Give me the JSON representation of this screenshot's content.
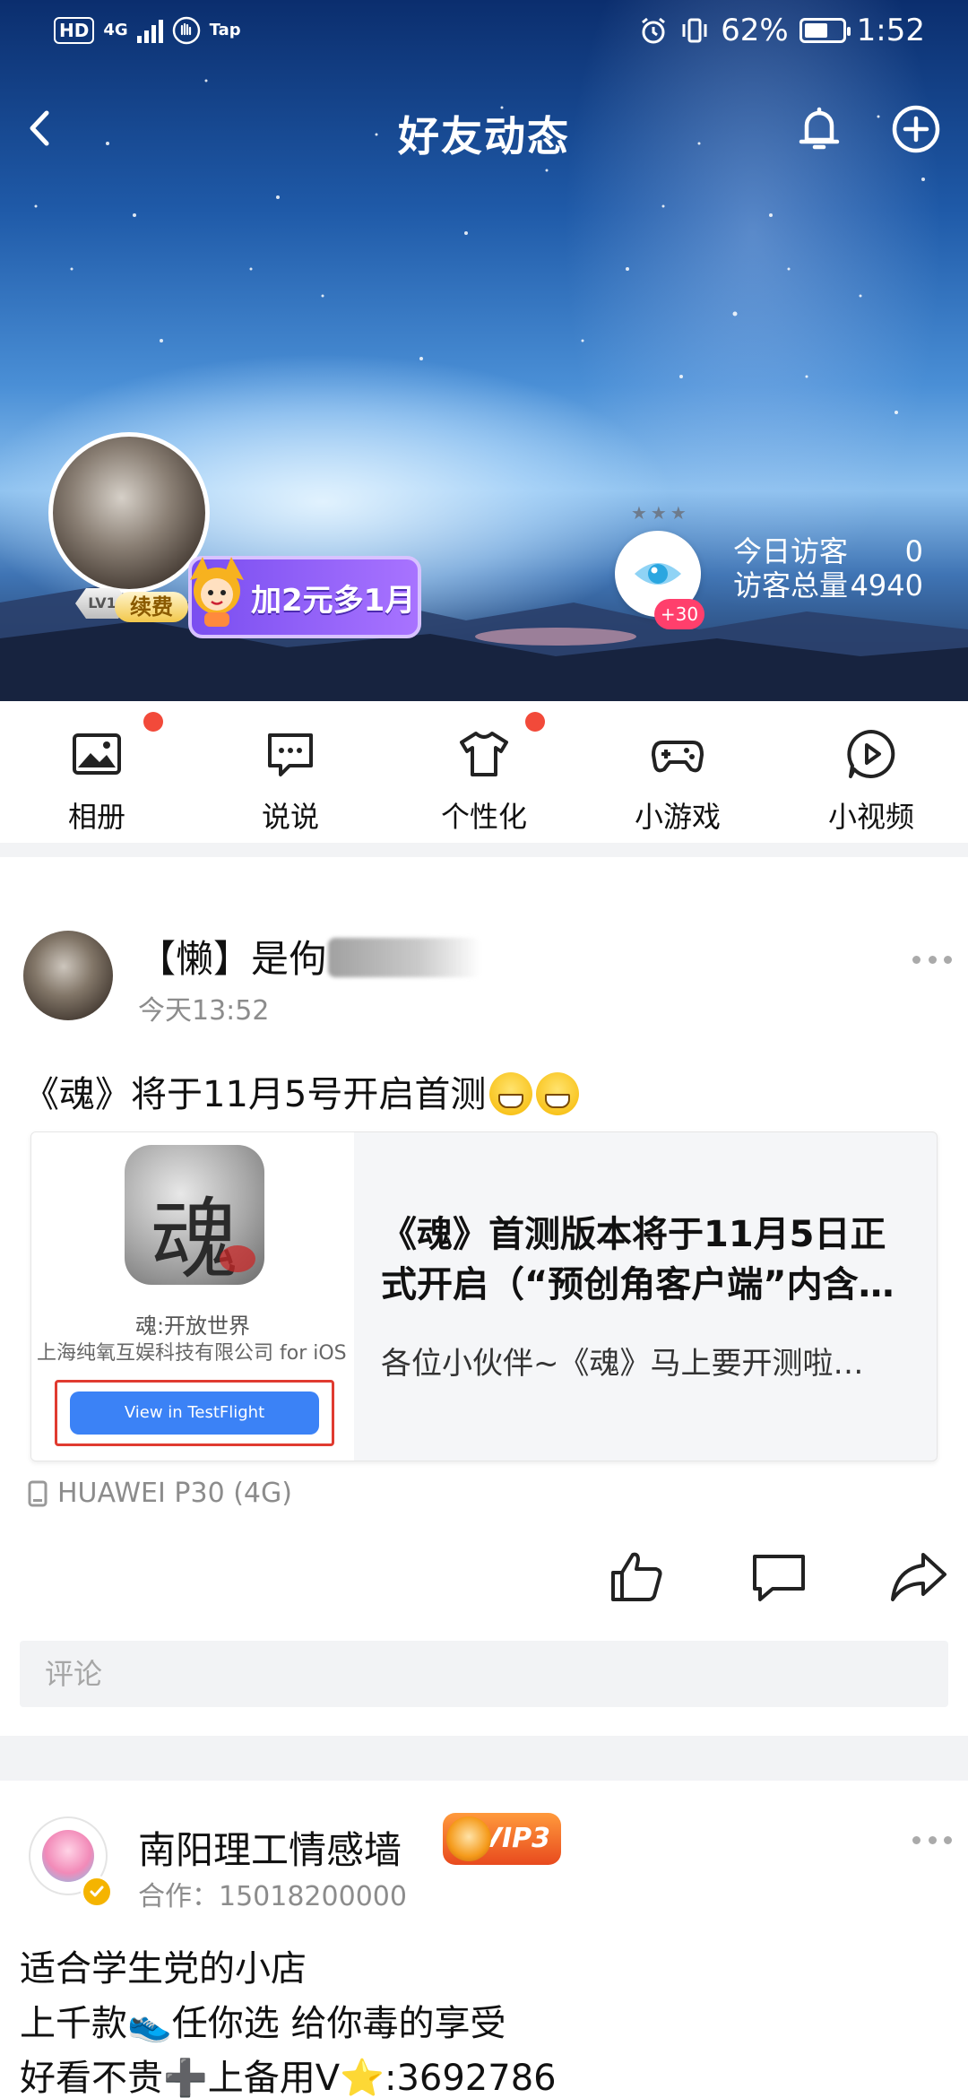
{
  "status_bar": {
    "hd": "HD",
    "network": "4G",
    "app_tag": "Tap",
    "battery": "62%",
    "battery_level": 0.62,
    "time": "1:52"
  },
  "nav": {
    "title": "好友动态",
    "back_icon": "chevron-left-icon",
    "bell_icon": "bell-icon",
    "add_icon": "plus-circle-icon"
  },
  "profile": {
    "level": "LV1",
    "renew_label": "续费",
    "promo_label": "加2元多1月",
    "visitor_bonus": "+30",
    "today_visitors_label": "今日访客",
    "today_visitors_value": "0",
    "total_visitors_label": "访客总量",
    "total_visitors_value": "4940"
  },
  "menu": [
    {
      "label": "相册",
      "icon": "photo-album-icon",
      "badge": true
    },
    {
      "label": "说说",
      "icon": "chat-bubble-icon",
      "badge": false
    },
    {
      "label": "个性化",
      "icon": "tshirt-icon",
      "badge": true
    },
    {
      "label": "小游戏",
      "icon": "gamepad-icon",
      "badge": false
    },
    {
      "label": "小视频",
      "icon": "play-circle-icon",
      "badge": false
    }
  ],
  "post1": {
    "author": "【懒】是佝",
    "time": "今天13:52",
    "text": "《魂》将于11月5号开启首测",
    "card": {
      "app_name": "魂:开放世界",
      "developer": "上海纯氧互娱科技有限公司 for iOS",
      "button": "View in TestFlight",
      "title": "《魂》首测版本将于11月5日正式开启（“预创角客户端”内含…",
      "desc": "各位小伙伴~《魂》马上要开测啦…"
    },
    "device": "HUAWEI P30 (4G)",
    "comment_placeholder": "评论"
  },
  "post2": {
    "author": "南阳理工情感墙",
    "vip": "VIP3",
    "subtitle": "合作：15018200000",
    "lines": [
      "适合学生党的小店",
      "上千款👟任你选 给你毒的享受",
      "好看不贵➕上备用V⭐:3692786"
    ]
  },
  "colors": {
    "accent_red": "#f24a3a",
    "link_blue": "#3b82f6",
    "promo_purple": "#7a4ef0",
    "visitor_pink": "#ff3f6c"
  }
}
